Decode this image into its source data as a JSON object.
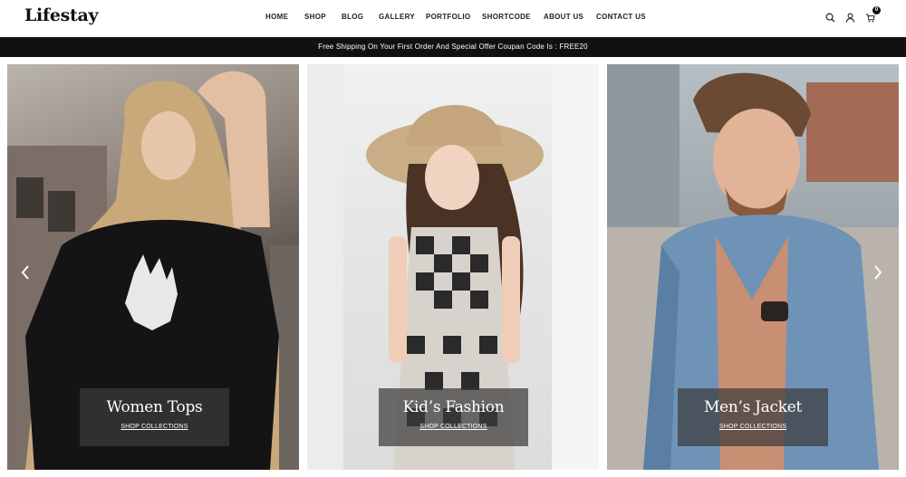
{
  "brand": {
    "logo": "Lifestay"
  },
  "nav": {
    "items": [
      {
        "label": "HOME"
      },
      {
        "label": "SHOP"
      },
      {
        "label": "BLOG"
      },
      {
        "label": "GALLERY"
      },
      {
        "label": "PORTFOLIO"
      },
      {
        "label": "SHORTCODE"
      },
      {
        "label": "ABOUT US"
      },
      {
        "label": "CONTACT US"
      }
    ]
  },
  "header_icons": {
    "search": "search-icon",
    "account": "user-icon",
    "cart": "cart-icon",
    "cart_count": "0"
  },
  "announcement": {
    "text": "Free Shipping On Your First Order And Special Offer Coupan Code Is : FREE20"
  },
  "slides": [
    {
      "title": "Women Tops",
      "link": "SHOP COLLECTIONS"
    },
    {
      "title": "Kid’s Fashion",
      "link": "SHOP COLLECTIONS"
    },
    {
      "title": "Men’s Jacket",
      "link": "SHOP COLLECTIONS"
    }
  ],
  "controls": {
    "prev_icon": "chevron-left-icon",
    "next_icon": "chevron-right-icon"
  },
  "colors": {
    "announcement_bg": "#111111",
    "caption_overlay": "#3c3c3c",
    "text_primary": "#111111"
  }
}
